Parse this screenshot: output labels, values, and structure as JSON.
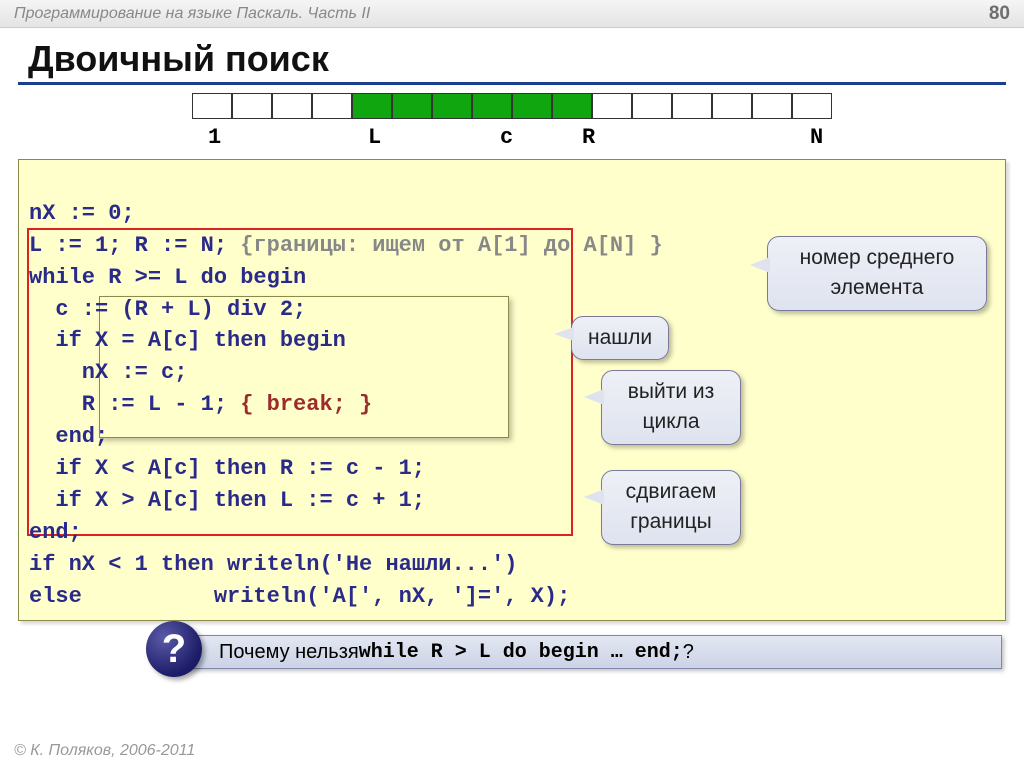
{
  "header": {
    "left": "Программирование на языке Паскаль. Часть II",
    "page": "80"
  },
  "title": "Двоичный поиск",
  "array": {
    "cell_states": [
      "",
      "",
      "",
      "",
      "g",
      "g",
      "g",
      "g",
      "g",
      "g",
      "",
      "",
      "",
      "",
      "",
      ""
    ],
    "labels": {
      "one": "1",
      "L": "L",
      "c": "c",
      "R": "R",
      "N": "N"
    }
  },
  "code": {
    "l1": "nX := 0;",
    "l2a": "L := 1; R := N; ",
    "l2b": "{границы: ищем от A[1] до A[N] }",
    "l3": "while R >= L do begin",
    "l4": "  c := (R + L) div 2;",
    "l5": "  if X = A[c] then begin",
    "l6": "    nX := c;",
    "l7a": "    R := L - 1; ",
    "l7b": "{ break; }",
    "l8": "  end;",
    "l9": "  if X < A[c] then R := c - 1;",
    "l10": "  if X > A[c] then L := c + 1;",
    "l11": "end;",
    "l12": "if nX < 1 then writeln('Не нашли...')",
    "l13": "else          writeln('A[', nX, ']=', X);"
  },
  "callouts": {
    "middle1": "номер среднего",
    "middle2": "элемента",
    "found": "нашли",
    "exit1": "выйти из",
    "exit2": "цикла",
    "shift1": "сдвигаем",
    "shift2": "границы"
  },
  "question": {
    "mark": "?",
    "pre": "Почему нельзя ",
    "code": "while R > L do begin … end;",
    "post": " ?"
  },
  "footer": "© К. Поляков, 2006-2011"
}
